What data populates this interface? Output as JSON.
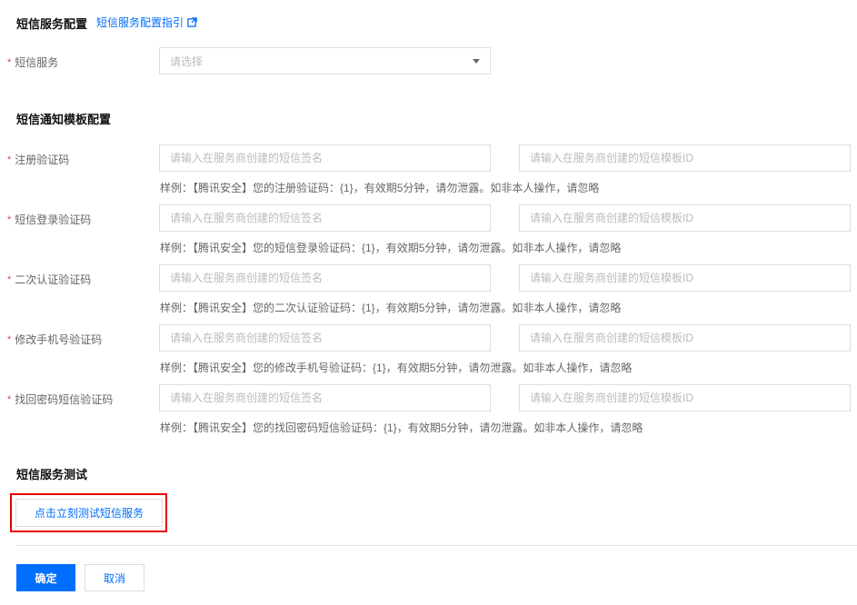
{
  "sms_config": {
    "title": "短信服务配置",
    "guide_link": "短信服务配置指引",
    "service_label": "短信服务",
    "service_placeholder": "请选择"
  },
  "template_config": {
    "title": "短信通知模板配置",
    "sign_placeholder": "请输入在服务商创建的短信签名",
    "template_placeholder": "请输入在服务商创建的短信模板ID",
    "rows": [
      {
        "label": "注册验证码",
        "example": "样例：【腾讯安全】您的注册验证码：{1}，有效期5分钟，请勿泄露。如非本人操作，请忽略"
      },
      {
        "label": "短信登录验证码",
        "example": "样例：【腾讯安全】您的短信登录验证码：{1}，有效期5分钟，请勿泄露。如非本人操作，请忽略"
      },
      {
        "label": "二次认证验证码",
        "example": "样例：【腾讯安全】您的二次认证验证码：{1}，有效期5分钟，请勿泄露。如非本人操作，请忽略"
      },
      {
        "label": "修改手机号验证码",
        "example": "样例：【腾讯安全】您的修改手机号验证码：{1}，有效期5分钟，请勿泄露。如非本人操作，请忽略"
      },
      {
        "label": "找回密码短信验证码",
        "example": "样例：【腾讯安全】您的找回密码短信验证码：{1}，有效期5分钟，请勿泄露。如非本人操作，请忽略"
      }
    ]
  },
  "sms_test": {
    "title": "短信服务测试",
    "test_button": "点击立刻测试短信服务"
  },
  "footer": {
    "confirm": "确定",
    "cancel": "取消"
  },
  "colors": {
    "accent": "#006eff",
    "required": "#e54545",
    "highlight_frame": "#e50000"
  }
}
